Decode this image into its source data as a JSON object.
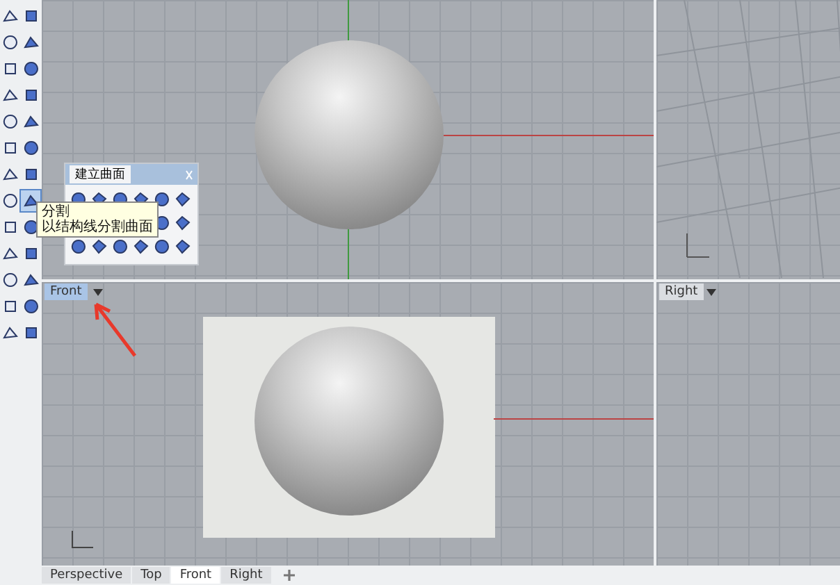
{
  "viewports": [
    {
      "label": "Front",
      "active": true
    },
    {
      "label": "Right",
      "active": false
    }
  ],
  "floating_panel": {
    "title": "建立曲面"
  },
  "tooltip": {
    "lines": [
      "分割",
      "以结构线分割曲面"
    ]
  },
  "tabs": [
    {
      "label": "Perspective",
      "selected": false
    },
    {
      "label": "Top",
      "selected": false
    },
    {
      "label": "Front",
      "selected": true
    },
    {
      "label": "Right",
      "selected": false
    }
  ]
}
